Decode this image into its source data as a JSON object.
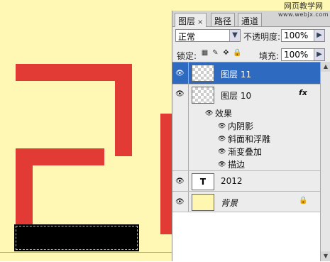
{
  "canvas": {
    "background": "#fef8b4",
    "shape_color": "#e23a35",
    "selection_color": "#000000"
  },
  "panel": {
    "tabs": [
      {
        "label": "图层",
        "close": "×",
        "active": true
      },
      {
        "label": "路径",
        "active": false
      },
      {
        "label": "通道",
        "active": false
      }
    ],
    "watermark": {
      "cn": "网页教学网",
      "en": "www.webjx.com"
    },
    "blend_mode": "正常",
    "opacity_label": "不透明度:",
    "opacity_value": "100%",
    "lock_label": "锁定:",
    "lock_icons": [
      "transparency-lock-icon",
      "brush-lock-icon",
      "move-lock-icon",
      "padlock-icon"
    ],
    "fill_label": "填充:",
    "fill_value": "100%",
    "layers": [
      {
        "name": "图层 11",
        "selected": true
      },
      {
        "name": "图层 10",
        "fx": "fx"
      },
      {
        "effects_label": "效果",
        "effects": [
          "内阴影",
          "斜面和浮雕",
          "渐变叠加",
          "描边"
        ]
      },
      {
        "name": "2012",
        "thumb_text": "T"
      },
      {
        "name": "背景",
        "locked": true,
        "thumb_color": "#fff7b0"
      }
    ],
    "selected_color": "#2e6ac0"
  }
}
